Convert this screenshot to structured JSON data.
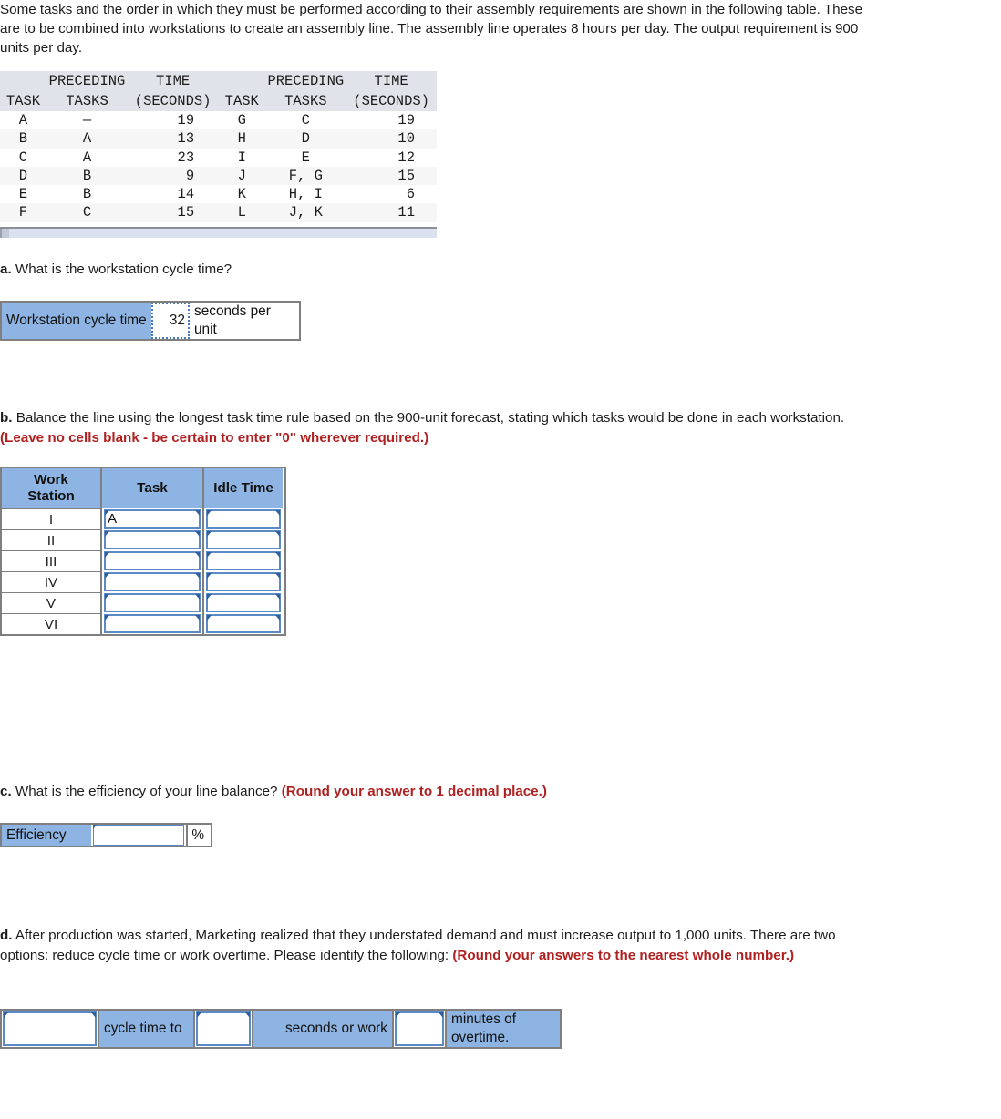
{
  "intro": "Some tasks and the order in which they must be performed according to their assembly requirements are shown in the following table. These are to be combined into workstations to create an assembly line. The assembly line operates 8 hours per day. The output requirement is 900 units per day.",
  "data_table": {
    "headers_top": [
      "",
      "PRECEDING",
      "TIME",
      "",
      "PRECEDING",
      "TIME"
    ],
    "headers_bottom": [
      "TASK",
      "TASKS",
      "(SECONDS)",
      "TASK",
      "TASKS",
      "(SECONDS)"
    ],
    "rows": [
      {
        "task": "A",
        "prec": "—",
        "time": "19",
        "task2": "G",
        "prec2": "C",
        "time2": "19"
      },
      {
        "task": "B",
        "prec": "A",
        "time": "13",
        "task2": "H",
        "prec2": "D",
        "time2": "10"
      },
      {
        "task": "C",
        "prec": "A",
        "time": "23",
        "task2": "I",
        "prec2": "E",
        "time2": "12"
      },
      {
        "task": "D",
        "prec": "B",
        "time": "9",
        "task2": "J",
        "prec2": "F, G",
        "time2": "15"
      },
      {
        "task": "E",
        "prec": "B",
        "time": "14",
        "task2": "K",
        "prec2": "H, I",
        "time2": "6"
      },
      {
        "task": "F",
        "prec": "C",
        "time": "15",
        "task2": "L",
        "prec2": "J, K",
        "time2": "11"
      }
    ]
  },
  "question_a": {
    "label": "a.",
    "text": "What is the workstation cycle time?",
    "row_label": "Workstation cycle time",
    "value": "32",
    "unit": "seconds per unit"
  },
  "question_b": {
    "label": "b.",
    "text": "Balance the line using the longest task time rule based on the 900-unit forecast, stating which tasks would be done in each workstation.",
    "note": "(Leave no cells blank - be certain to enter \"0\" wherever required.)",
    "table": {
      "headers": [
        "Work Station",
        "Task",
        "Idle Time"
      ],
      "header_work": "Work",
      "header_station": "Station",
      "header_task": "Task",
      "header_idle": "Idle Time",
      "rows": [
        {
          "station": "I",
          "task": "A",
          "idle": ""
        },
        {
          "station": "II",
          "task": "",
          "idle": ""
        },
        {
          "station": "III",
          "task": "",
          "idle": ""
        },
        {
          "station": "IV",
          "task": "",
          "idle": ""
        },
        {
          "station": "V",
          "task": "",
          "idle": ""
        },
        {
          "station": "VI",
          "task": "",
          "idle": ""
        }
      ]
    }
  },
  "question_c": {
    "label": "c.",
    "text": "What is the efficiency of your line balance?",
    "note": "(Round your answer to 1 decimal place.)",
    "row_label": "Efficiency",
    "value": "",
    "unit": "%"
  },
  "question_d": {
    "label": "d.",
    "text": "After production was started, Marketing realized that they understated demand and must increase output to 1,000 units. There are two options: reduce cycle time or work overtime. Please identify the following:",
    "note": "(Round your answers to the nearest whole number.)",
    "field1": "",
    "label1": "cycle time to",
    "field2": "",
    "label2": "seconds or work",
    "field3": "",
    "label3": "minutes of overtime."
  },
  "colors": {
    "cell_blue": "#8db4e2",
    "note_red": "#b02020",
    "table_header_bg": "#e0e3e9",
    "alt_row_bg": "#f6f6f6",
    "input_border": "#5b8ac6",
    "grid_border": "#7f7f7f"
  }
}
